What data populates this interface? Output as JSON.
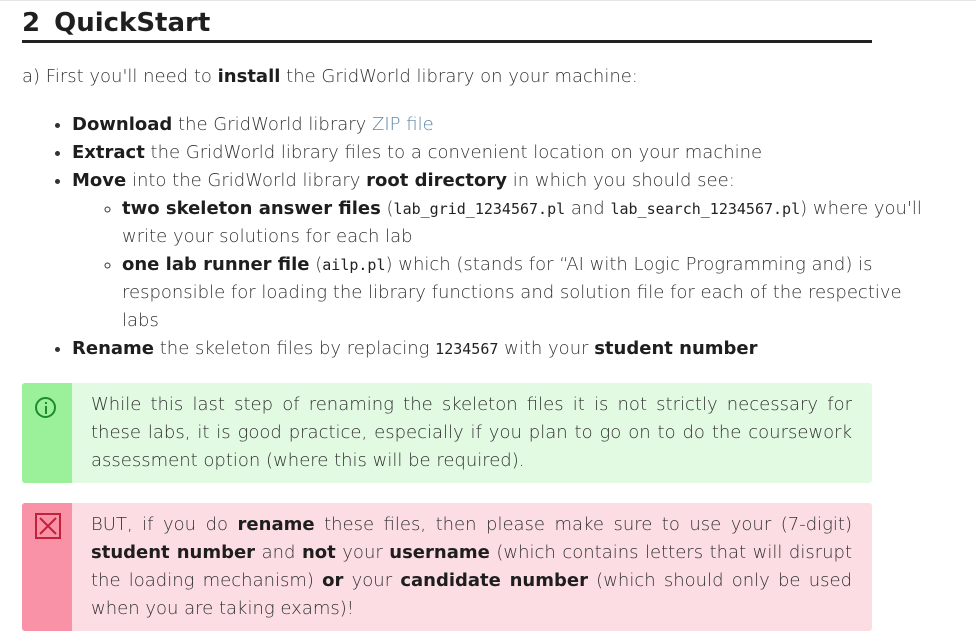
{
  "section": {
    "number": "2",
    "title": "QuickStart"
  },
  "intro": {
    "prefix": "a) First you'll need to ",
    "bold": "install",
    "suffix": " the GridWorld library on your machine:"
  },
  "steps": {
    "download": {
      "bold": "Download",
      "text": " the GridWorld library ",
      "link": "ZIP file"
    },
    "extract": {
      "bold": "Extract",
      "text": " the GridWorld library files to a convenient location on your machine"
    },
    "move": {
      "bold": "Move",
      "text1": " into the GridWorld library ",
      "bold2": "root directory",
      "text2": " in which you should see:",
      "sub1": {
        "bold": "two skeleton answer files",
        "open": " (",
        "code1": "lab_grid_1234567.pl",
        "and": " and ",
        "code2": "lab_search_1234567.pl",
        "close": ")",
        "rest": " where you'll write your solutions for each lab"
      },
      "sub2": {
        "bold": "one lab runner file",
        "open": " (",
        "code": "ailp.pl",
        "rest": ") which (stands for “AI with Logic Programming and) is responsible for loading the library functions and solution file for each of the respective labs"
      }
    },
    "rename": {
      "bold": "Rename",
      "text1": " the skeleton files by replacing ",
      "code": "1234567",
      "text2": " with your ",
      "bold2": "student number"
    }
  },
  "info_box": {
    "icon": "info-circle-icon",
    "text": "While this last step of renaming the skeleton files it is not strictly necessary for these labs, it is good practice, especially if you plan to go on to do the coursework assessment option (where this will be required)."
  },
  "warning_box": {
    "icon": "x-box-icon",
    "t1": "BUT, if you do ",
    "b1": "rename",
    "t2": " these files, then please make sure to use your (7-digit) ",
    "b2": "student number",
    "t3": " and ",
    "b3": "not",
    "t4": " your ",
    "b4": "username",
    "t5": " (which contains letters that will disrupt the loading mechanism) ",
    "b5": "or",
    "t6": " your ",
    "b6": "candidate number",
    "t7": " (which should only be used when you are taking exams)!"
  },
  "colors": {
    "info_bg": "#e2f9e2",
    "info_bar": "#9af19a",
    "info_icon": "#1e8a28",
    "warn_bg": "#fbdde3",
    "warn_bar": "#f992a6",
    "warn_icon": "#c0223a",
    "link": "#5a86a6"
  }
}
